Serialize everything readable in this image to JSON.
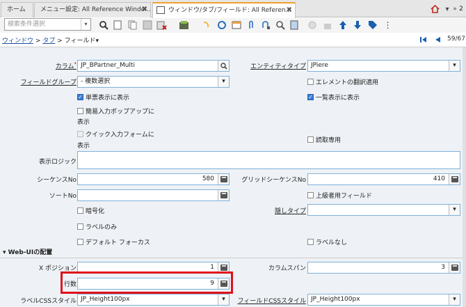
{
  "tabs": [
    {
      "label": "ホーム"
    },
    {
      "label": "メニュー設定: All Reference Windo..."
    },
    {
      "label": "ウィンドウ/タブ/フィールド: All Referen..."
    }
  ],
  "topright": {
    "count": "2"
  },
  "search": {
    "placeholder": "検索条件選択"
  },
  "breadcrumb": {
    "window": "ウィンドウ",
    "tab": "タブ",
    "field": "フィールド",
    "sep": ">",
    "record": "59/67"
  },
  "form": {
    "column_label": "カラム",
    "column_value": "JP_BPartner_Multi",
    "entity_label": "エンティティタイプ",
    "entity_value": "JPiere",
    "fieldgroup_label": "フィールドグループ",
    "fieldgroup_value": "- 複数選択",
    "elem_trans": "エレメントの翻訳適用",
    "single_disp": "単票表示に表示",
    "list_disp": "一覧表示に表示",
    "quick_popup_1": "簡易入力ポップアップに",
    "quick_popup_2": "表示",
    "quick_form_1": "クイック入力フォームに",
    "quick_form_2": "表示",
    "readonly": "読取専用",
    "display_logic": "表示ロジック",
    "seq_label": "シーケンスNo",
    "seq_value": "580",
    "grid_seq_label": "グリッドシーケンスNo",
    "grid_seq_value": "410",
    "sort_label": "ソートNo",
    "sort_value": "",
    "advanced": "上級者用フィールド",
    "encrypted": "暗号化",
    "hide_type_label": "隠しタイプ",
    "hide_type_value": "",
    "label_only": "ラベルのみ",
    "default_focus": "デフォルト フォーカス",
    "no_label": "ラベルなし",
    "section": "Web-UIの配置",
    "xpos_label": "X ポジション",
    "xpos_value": "1",
    "colspan_label": "カラムスパン",
    "colspan_value": "3",
    "rows_label": "行数",
    "rows_value": "9",
    "label_css_label": "ラベルCSSスタイル",
    "label_css_value": "JP_Height100px",
    "field_css_label": "フィールドCSSスタイル",
    "field_css_value": "JP_Height100px"
  },
  "colors": {
    "accent": "#3a7bd5",
    "highlight": "#e0101a"
  }
}
